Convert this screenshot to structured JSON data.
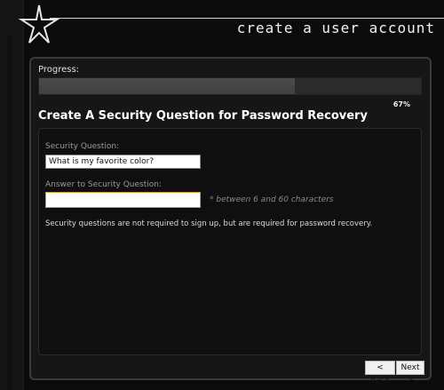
{
  "header": {
    "title": "create a user account",
    "logo_icon": "star-logo-icon"
  },
  "progress": {
    "label": "Progress:",
    "value_percent": 67,
    "percent_text": "67%"
  },
  "section": {
    "heading": "Create A Security Question for Password Recovery"
  },
  "form": {
    "question_label": "Security Question:",
    "question_value": "What is my favorite color?",
    "answer_label": "Answer to Security Question:",
    "answer_value": "",
    "answer_hint": "* between 6 and 60 characters",
    "note": "Security questions are not required to sign up, but are required for password recovery."
  },
  "nav": {
    "back_label": "< Back",
    "next_label": "Next >"
  },
  "colors": {
    "background": "#0b0b0b",
    "panel": "#161616",
    "answer_focus_border": "#c8a040"
  }
}
